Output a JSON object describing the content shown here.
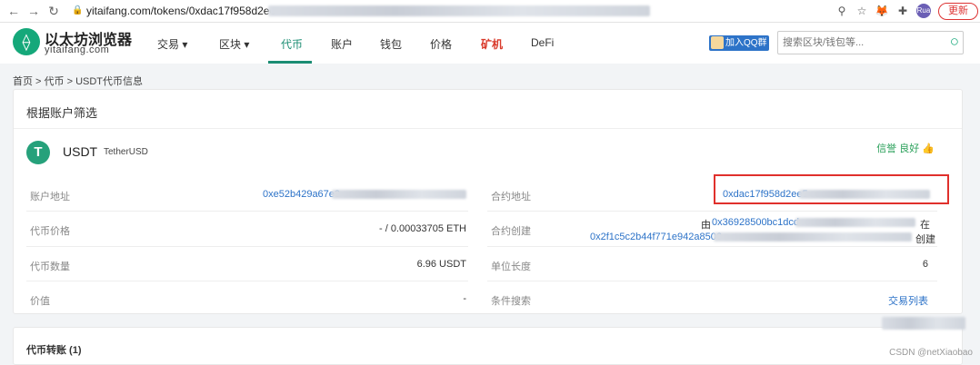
{
  "browser": {
    "url": "yitaifang.com/tokens/0xdac17f958d2ee",
    "update_label": "更新",
    "profile_label": "Rua",
    "back_glyph": "←",
    "forward_glyph": "→",
    "reload_glyph": "↻",
    "lock_glyph": "🔒",
    "location_glyph": "⚲",
    "star_glyph": "☆",
    "fox_glyph": "🦊",
    "puzzle_glyph": "✚"
  },
  "site": {
    "name": "以太坊浏览器",
    "domain": "yitaifang.com",
    "logo_glyph": "⟠",
    "brand_color": "#1b8d73"
  },
  "nav": {
    "items": [
      "交易 ▾",
      "区块 ▾",
      "代币",
      "账户",
      "钱包",
      "价格",
      "矿机",
      "DeFi"
    ],
    "active": "代币",
    "highlight": "矿机"
  },
  "qq_button": "加入QQ群",
  "search": {
    "placeholder": "搜索区块/钱包等...",
    "icon_glyph": "○"
  },
  "breadcrumb": "首页 > 代币 > USDT代币信息",
  "filter_title": "根据账户筛选",
  "token": {
    "icon_glyph": "T",
    "symbol": "USDT",
    "name": "TetherUSD",
    "credit": "信誉 良好 👍"
  },
  "left_rows": [
    {
      "label": "账户地址",
      "value": "0xe52b429a67e3"
    },
    {
      "label": "代币价格",
      "value": "- / 0.00033705 ETH"
    },
    {
      "label": "代币数量",
      "value": "6.96 USDT"
    },
    {
      "label": "价值",
      "value": "-"
    }
  ],
  "right_rows": [
    {
      "label": "合约地址",
      "value": "0xdac17f958d2ee5"
    },
    {
      "label": "合约创建",
      "value_prefix": "由",
      "creator": "0x36928500bc1dcd",
      "suffix_1": "在",
      "tx": "0x2f1c5c2b44f771e942a8506",
      "suffix_2": "创建"
    },
    {
      "label": "单位长度",
      "value": "6"
    },
    {
      "label": "条件搜索",
      "value": "交易列表"
    }
  ],
  "transfers_title": "代币转账 (1)",
  "watermark": "CSDN @netXiaobao"
}
